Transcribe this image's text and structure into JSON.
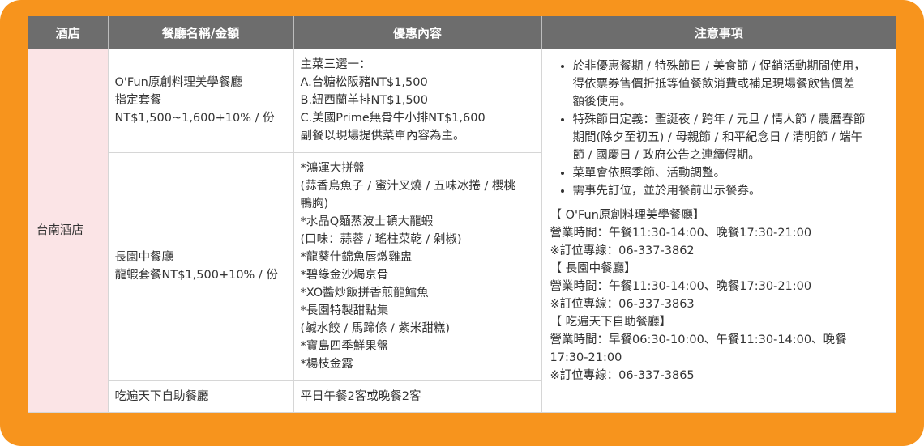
{
  "headers": [
    "酒店",
    "餐廳名稱/金額",
    "優惠內容",
    "注意事項"
  ],
  "hotel": "台南酒店",
  "rows": [
    {
      "restaurant_lines": [
        "O'Fun原創料理美學餐廳",
        "指定套餐",
        "NT$1,500~1,600+10% / 份"
      ],
      "offer_lines": [
        "主菜三選一：",
        "A.台糖松阪豬NT$1,500",
        "B.紐西蘭羊排NT$1,500",
        "C.美國Prime無骨牛小排NT$1,600",
        "副餐以現場提供菜單內容為主。"
      ]
    },
    {
      "restaurant_lines": [
        "長園中餐廳",
        "龍蝦套餐NT$1,500+10% / 份"
      ],
      "offer_lines": [
        "*鴻運大拼盤",
        "(蒜香烏魚子 / 蜜汁叉燒 / 五味冰捲 / 櫻桃",
        "鴨胸)",
        "*水晶Q麵蒸波士頓大龍蝦",
        "(口味：蒜蓉 / 瑤柱菜乾 / 剁椒)",
        "*龍葵什錦魚唇燉雞盅",
        "*碧綠金沙焗京骨",
        "*XO醬炒飯拼香煎龍鱈魚",
        "*長園特製甜點集",
        "(鹹水餃 / 馬蹄條 / 紫米甜糕)",
        "*寶島四季鮮果盤",
        "*楊枝金露"
      ]
    },
    {
      "restaurant_lines": [
        "吃遍天下自助餐廳"
      ],
      "offer_lines": [
        "平日午餐2客或晚餐2客"
      ]
    }
  ],
  "notes": {
    "bullets": [
      [
        "於非優惠餐期 / 特殊節日 / 美食節 / 促銷活動期間使用，",
        "得依票券售價折抵等值餐飲消費或補足現場餐飲售價差",
        "額後使用。"
      ],
      [
        "特殊節日定義：聖誕夜 / 跨年 / 元旦 / 情人節 / 農曆春節",
        "期間(除夕至初五) / 母親節 / 和平紀念日 / 清明節 / 端午",
        "節 / 國慶日 / 政府公告之連續假期。"
      ],
      [
        "菜單會依照季節、活動調整。"
      ],
      [
        "需事先訂位，並於用餐前出示餐券。"
      ]
    ],
    "sections": [
      [
        "【 O'Fun原創料理美學餐廳】",
        "營業時間：午餐11:30-14:00、晚餐17:30-21:00",
        "※訂位專線：06-337-3862"
      ],
      [
        "【 長園中餐廳】",
        "營業時間：午餐11:30-14:00、晚餐17:30-21:00",
        "※訂位專線：06-337-3863"
      ],
      [
        "【 吃遍天下自助餐廳】",
        "營業時間：早餐06:30-10:00、午餐11:30-14:00、晚餐",
        "17:30-21:00",
        "※訂位專線：06-337-3865"
      ]
    ]
  }
}
